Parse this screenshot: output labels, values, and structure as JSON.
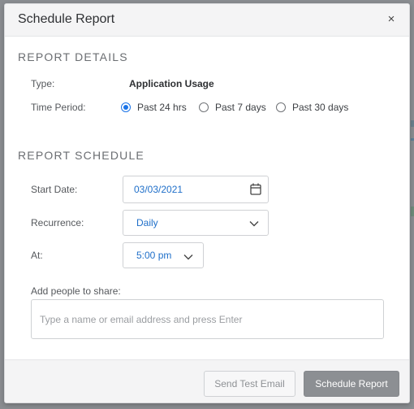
{
  "dialog": {
    "title": "Schedule Report",
    "close_label": "×"
  },
  "report_details": {
    "heading": "REPORT DETAILS",
    "type_label": "Type:",
    "type_value": "Application Usage",
    "time_period_label": "Time Period:",
    "time_period_options": [
      {
        "label": "Past 24 hrs",
        "selected": true
      },
      {
        "label": "Past 7 days",
        "selected": false
      },
      {
        "label": "Past 30 days",
        "selected": false
      }
    ]
  },
  "report_schedule": {
    "heading": "REPORT SCHEDULE",
    "start_date_label": "Start Date:",
    "start_date_value": "03/03/2021",
    "recurrence_label": "Recurrence:",
    "recurrence_value": "Daily",
    "at_label": "At:",
    "at_value": "5:00 pm",
    "share_label": "Add people to share:",
    "share_placeholder": "Type a name or email address and press Enter",
    "share_value": ""
  },
  "footer": {
    "send_test_email_label": "Send Test Email",
    "schedule_report_label": "Schedule Report"
  },
  "icons": {
    "calendar": "calendar-icon",
    "chevron": "chevron-down-icon",
    "close": "close-icon"
  },
  "colors": {
    "accent": "#1a73e8",
    "value_text": "#1f6fc9",
    "primary_button": "#8c8f93"
  }
}
